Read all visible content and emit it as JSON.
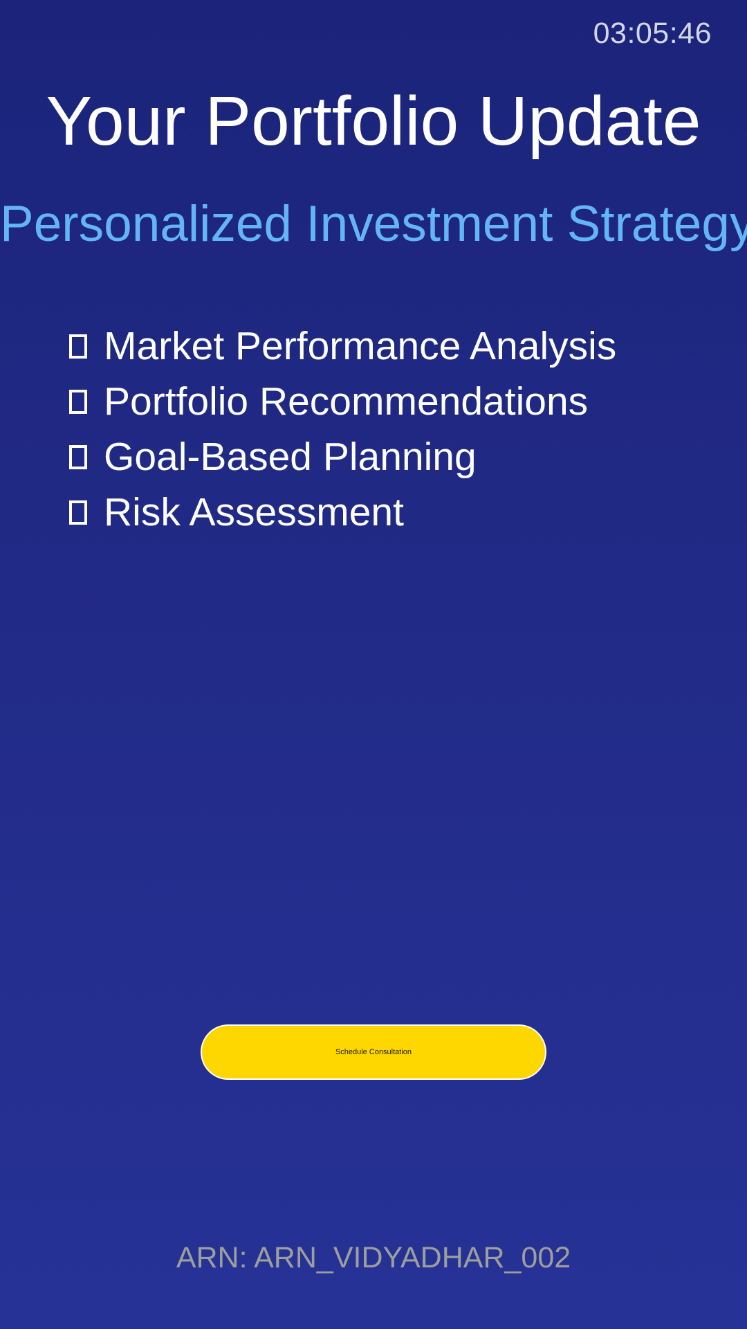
{
  "clock": {
    "time": "03:05:46"
  },
  "header": {
    "title": "Your Portfolio Update",
    "subtitle": "Personalized Investment Strategy"
  },
  "features": [
    {
      "label": "Market Performance Analysis",
      "icon": "checkbox-empty-icon"
    },
    {
      "label": "Portfolio Recommendations",
      "icon": "checkbox-empty-icon"
    },
    {
      "label": "Goal-Based Planning",
      "icon": "checkbox-empty-icon"
    },
    {
      "label": "Risk Assessment",
      "icon": "checkbox-empty-icon"
    }
  ],
  "cta": {
    "label": "Schedule Consultation"
  },
  "footer": {
    "arn": "ARN: ARN_VIDYADHAR_002"
  },
  "colors": {
    "background_top": "#1b247a",
    "background_bottom": "#263296",
    "subtitle": "#64b5f6",
    "button": "#ffd700",
    "footer_text": "#9e9e9e"
  }
}
